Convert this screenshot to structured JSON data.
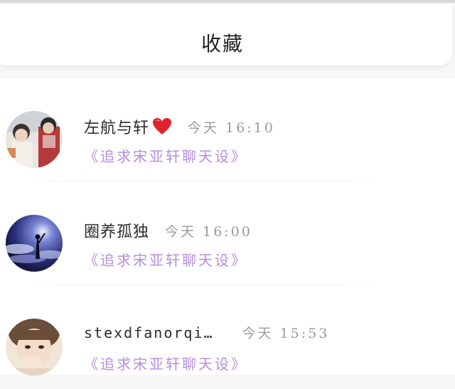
{
  "header": {
    "title": "收藏"
  },
  "items": [
    {
      "name": "左航与轩",
      "has_heart": true,
      "time": "今天 16:10",
      "subtitle": "《追求宋亚轩聊天设》"
    },
    {
      "name": "圈养孤独",
      "has_heart": false,
      "time": "今天 16:00",
      "subtitle": "《追求宋亚轩聊天设》"
    },
    {
      "name": "stexdfanorqi…",
      "has_heart": false,
      "time": "今天 15:53",
      "subtitle": "《追求宋亚轩聊天设》"
    }
  ],
  "colors": {
    "subtitle": "#b48ee0",
    "time": "#9a9a9a",
    "heart": "#e0242e"
  },
  "icons": {
    "heart": "red-heart-icon"
  }
}
